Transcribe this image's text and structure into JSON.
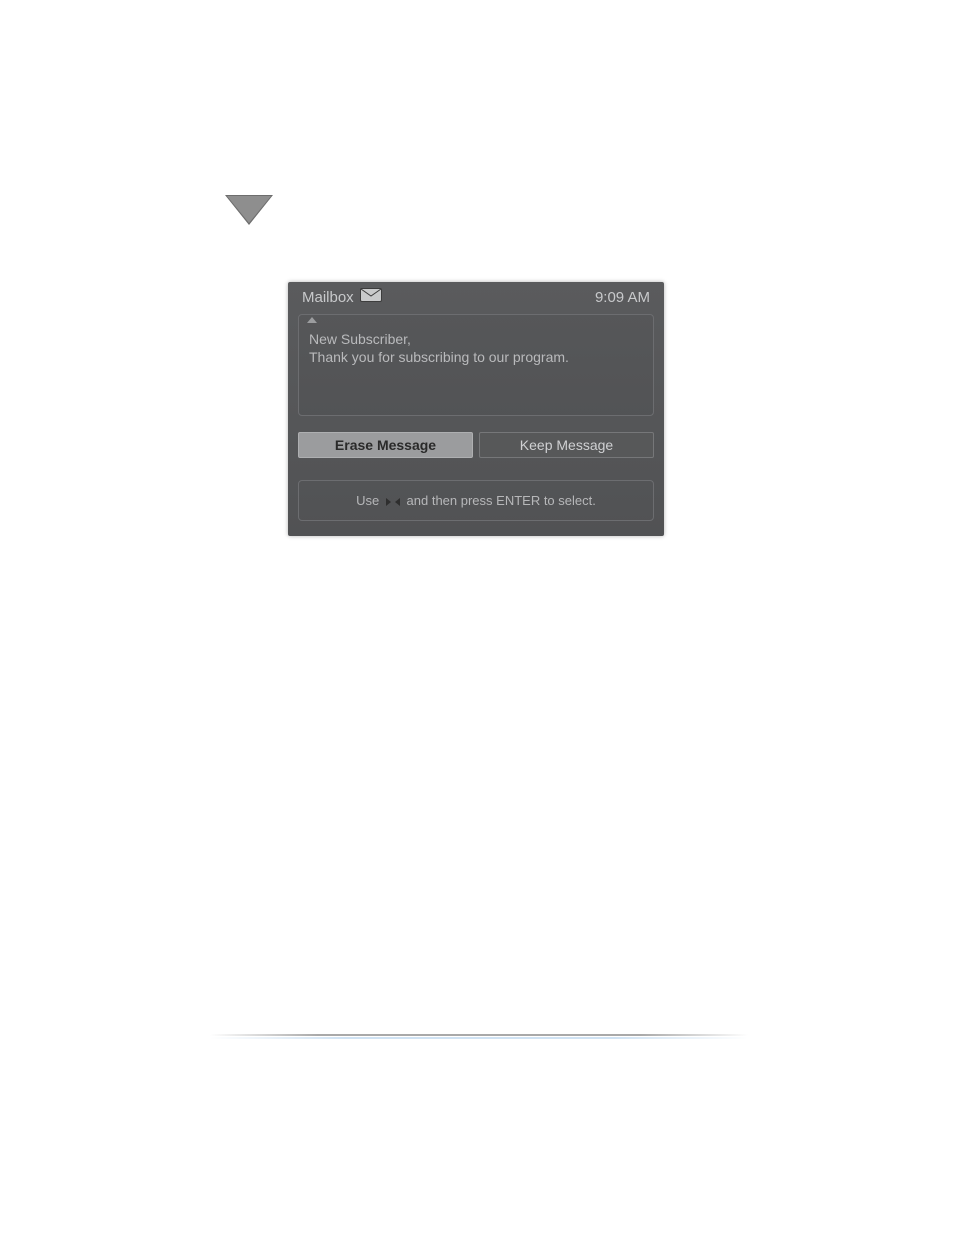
{
  "decorations": {
    "triangle": "down-triangle"
  },
  "mailbox": {
    "title": "Mailbox",
    "icon": "envelope-icon",
    "time": "9:09 AM",
    "message": {
      "line1": "New Subscriber,",
      "line2": "Thank you for subscribing to our program."
    },
    "buttons": {
      "erase": "Erase Message",
      "keep": "Keep Message"
    },
    "hint": {
      "pre": "Use",
      "post": "and then press ENTER to select."
    }
  }
}
